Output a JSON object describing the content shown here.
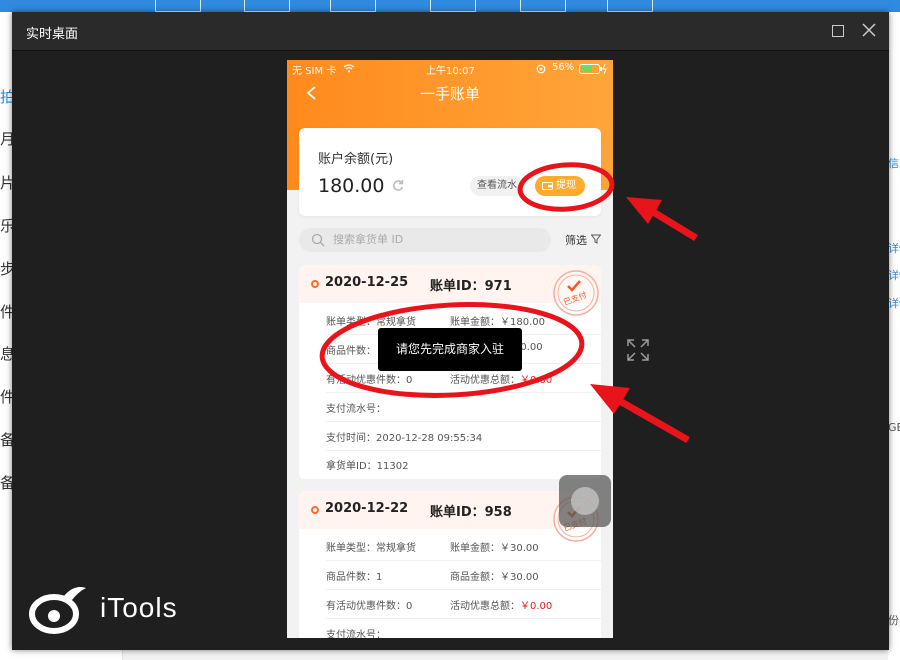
{
  "window": {
    "title": "实时桌面"
  },
  "background_app": {
    "left_items": [
      "拍",
      "月",
      "片",
      "乐",
      "步",
      "件",
      "息",
      "件",
      "备",
      "备"
    ],
    "right_items": [
      "信息",
      "详情",
      "详情",
      "详情"
    ],
    "right_misc": [
      "GB",
      "份"
    ]
  },
  "branding": {
    "name": "iTools"
  },
  "phone": {
    "status": {
      "carrier": "无 SIM 卡",
      "time": "上午10:07",
      "battery": "56%"
    },
    "nav": {
      "title": "一手账单"
    },
    "account": {
      "label": "账户余额(元)",
      "balance": "180.00",
      "view_flow": "查看流水",
      "withdraw": "提现"
    },
    "search": {
      "placeholder": "搜索拿货单 ID",
      "filter": "筛选"
    },
    "bills": [
      {
        "date": "2020-12-25",
        "id_label": "账单ID：971",
        "stamp": "已支付",
        "type": "账单类型：常规拿货",
        "amount": "账单金额：￥180.00",
        "count": "商品件数：",
        "goods_amount": "30.00",
        "promo_count": "有活动优惠件数：0",
        "promo_total_label": "活动优惠总额：",
        "promo_total_value": "￥0.00",
        "pay_serial": "支付流水号：",
        "pay_time": "支付时间：2020-12-28 09:55:34",
        "order_id": "拿货单ID：11302"
      },
      {
        "date": "2020-12-22",
        "id_label": "账单ID：958",
        "stamp": "已支付",
        "type": "账单类型：常规拿货",
        "amount": "账单金额：￥30.00",
        "count": "商品件数：1",
        "goods_amount": "商品金额：￥30.00",
        "promo_count": "有活动优惠件数：0",
        "promo_total_label": "活动优惠总额：",
        "promo_total_value": "￥0.00",
        "pay_serial": "支付流水号："
      }
    ],
    "toast": "请您先完成商家入驻"
  },
  "colors": {
    "orange": "#ff8a1c",
    "accent": "#ffab2e",
    "annotation_red": "#e8141c",
    "window_bg": "#1f1f1f"
  }
}
